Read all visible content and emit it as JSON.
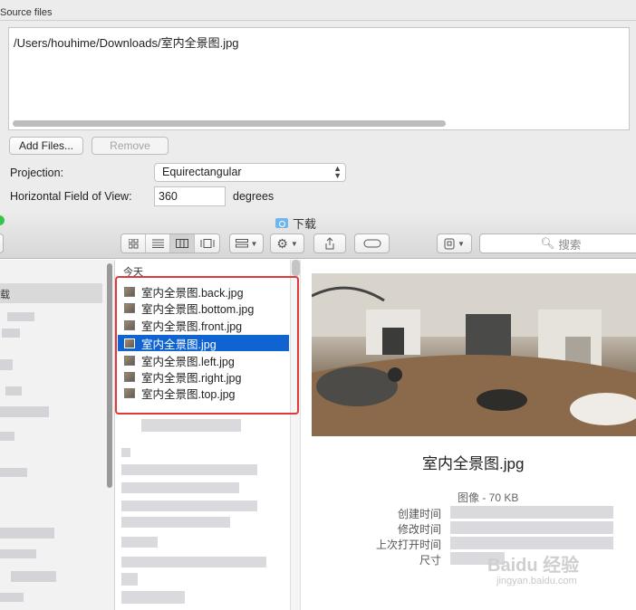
{
  "dialog": {
    "section_title": "Source files",
    "file_path": "/Users/houhime/Downloads/室内全景图.jpg",
    "add_files_label": "Add Files...",
    "remove_label": "Remove",
    "projection_label": "Projection:",
    "projection_value": "Equirectangular",
    "fov_label": "Horizontal Field of View:",
    "fov_value": "360",
    "fov_unit": "degrees"
  },
  "finder": {
    "window_title": "下载",
    "search_placeholder": "搜索",
    "toolbar_icons": [
      "icon-view-icon",
      "list-view-icon",
      "column-view-icon",
      "gallery-view-icon",
      "group-icon",
      "gear-icon",
      "share-icon",
      "tag-icon",
      "dropbox-icon"
    ],
    "sidebar_selected": "载",
    "column_header": "今天",
    "files": [
      {
        "name": "室内全景图.back.jpg",
        "selected": false
      },
      {
        "name": "室内全景图.bottom.jpg",
        "selected": false
      },
      {
        "name": "室内全景图.front.jpg",
        "selected": false
      },
      {
        "name": "室内全景图.jpg",
        "selected": true
      },
      {
        "name": "室内全景图.left.jpg",
        "selected": false
      },
      {
        "name": "室内全景图.right.jpg",
        "selected": false
      },
      {
        "name": "室内全景图.top.jpg",
        "selected": false
      }
    ],
    "preview": {
      "name": "室内全景图.jpg",
      "summary": "图像 - 70 KB",
      "created_key": "创建时间",
      "modified_key": "修改时间",
      "opened_key": "上次打开时间",
      "size_key": "尺寸"
    }
  },
  "watermark": {
    "text": "Baidu 经验",
    "sub": "jingyan.baidu.com"
  },
  "colors": {
    "selection": "#0f64d2",
    "highlight_box": "#e0393c",
    "traffic_green": "#36c44a"
  }
}
